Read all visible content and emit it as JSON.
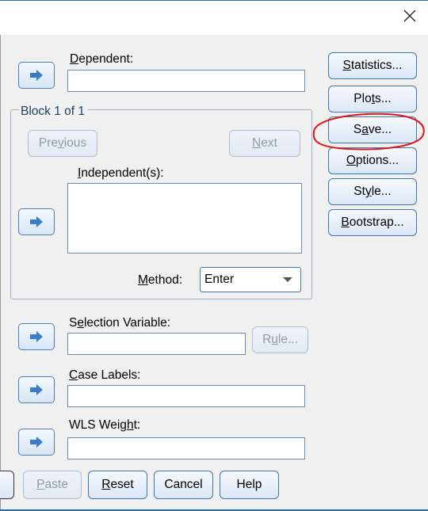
{
  "window": {
    "close_icon": "close-icon"
  },
  "dependent": {
    "label_u": "D",
    "label_rest": "ependent:",
    "value": ""
  },
  "block": {
    "legend": "Block 1 of 1",
    "previous_pre": "Pre",
    "previous_u": "v",
    "previous_post": "ious",
    "next_u": "N",
    "next_rest": "ext"
  },
  "independent": {
    "label_u": "I",
    "label_rest": "ndependent(s):"
  },
  "method": {
    "label_u": "M",
    "label_rest": "ethod:",
    "selected": "Enter"
  },
  "selection": {
    "label_pre": "S",
    "label_u": "e",
    "label_post": "lection Variable:",
    "rule_pre": "R",
    "rule_u": "u",
    "rule_post": "le..."
  },
  "case_labels": {
    "label_u": "C",
    "label_rest": "ase Labels:"
  },
  "wls": {
    "label_pre": "WLS Weig",
    "label_u": "h",
    "label_post": "t:"
  },
  "side_buttons": {
    "statistics_u": "S",
    "statistics_rest": "tatistics...",
    "plots_pre": "Plo",
    "plots_u": "t",
    "plots_post": "s...",
    "save_pre": "S",
    "save_u": "a",
    "save_post": "ve...",
    "options_u": "O",
    "options_rest": "ptions...",
    "style_pre": "St",
    "style_u": "y",
    "style_post": "le...",
    "bootstrap_u": "B",
    "bootstrap_rest": "ootstrap..."
  },
  "bottom_buttons": {
    "paste_u": "P",
    "paste_rest": "aste",
    "reset_u": "R",
    "reset_rest": "eset",
    "cancel": "Cancel",
    "help": "Help"
  },
  "colors": {
    "accent": "#2b6cb0",
    "arrow": "#3a7cc8",
    "annotation": "#d9191b"
  }
}
